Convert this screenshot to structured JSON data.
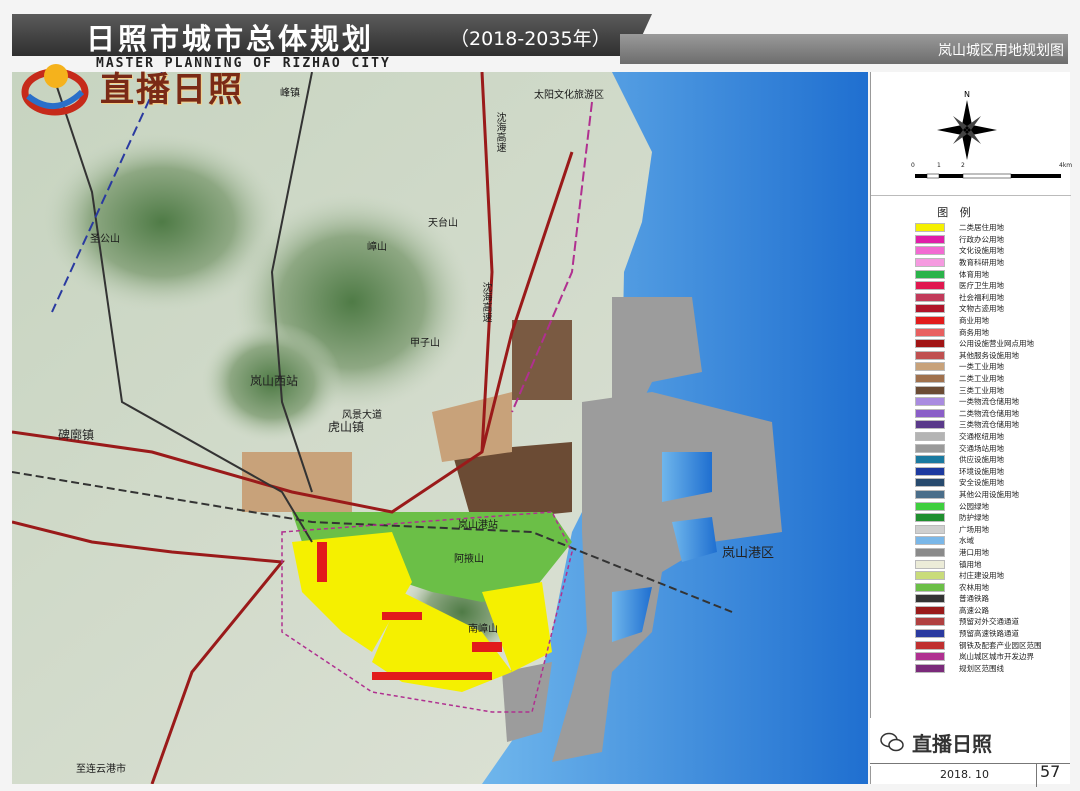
{
  "header": {
    "title_cn": "日照市城市总体规划",
    "title_years": "（2018-2035年）",
    "title_en": "MASTER PLANNING OF RIZHAO CITY",
    "subtitle": "岚山城区用地规划图"
  },
  "logo": {
    "text": "直播日照"
  },
  "map": {
    "labels": {
      "top_town": "峰镇",
      "taiyang": "太阳文化旅游区",
      "shenhai_highway": "沈海高速",
      "shenhai_highway2": "沈海高速",
      "tiantai": "天台山",
      "zhisheng": "圣公山",
      "rong": "嶂山",
      "jiajia": "甲子山",
      "lanshan_west_station": "岚山西站",
      "hushan_town": "虎山镇",
      "beizhai_town": "碑廓镇",
      "lanshan_port_station": "岚山港站",
      "afushan": "阿掖山",
      "nanshan": "南嶂山",
      "lanshan_port_zone": "岚山港区",
      "lianyungang": "至连云港市",
      "fenghua": "风景大道"
    }
  },
  "legend": {
    "title": "图 例",
    "scale_labels": [
      "0",
      "1",
      "2",
      "4km"
    ],
    "items": [
      {
        "label": "二类居住用地",
        "color": "#f5f000"
      },
      {
        "label": "行政办公用地",
        "color": "#e01ea8"
      },
      {
        "label": "文化设施用地",
        "color": "#f26ad2"
      },
      {
        "label": "教育科研用地",
        "color": "#f59ae0"
      },
      {
        "label": "体育用地",
        "color": "#2bb34a"
      },
      {
        "label": "医疗卫生用地",
        "color": "#e0174f"
      },
      {
        "label": "社会福利用地",
        "color": "#c23a5a"
      },
      {
        "label": "文物古迹用地",
        "color": "#b0142a"
      },
      {
        "label": "商业用地",
        "color": "#e21b1b"
      },
      {
        "label": "商务用地",
        "color": "#e86060"
      },
      {
        "label": "公用设施营业网点用地",
        "color": "#a11414"
      },
      {
        "label": "其他服务设施用地",
        "color": "#c05050"
      },
      {
        "label": "一类工业用地",
        "color": "#c8a27a"
      },
      {
        "label": "二类工业用地",
        "color": "#a0714d"
      },
      {
        "label": "三类工业用地",
        "color": "#6b4b34"
      },
      {
        "label": "一类物流仓储用地",
        "color": "#a98be0"
      },
      {
        "label": "二类物流仓储用地",
        "color": "#8a5ec8"
      },
      {
        "label": "三类物流仓储用地",
        "color": "#5a3a8a"
      },
      {
        "label": "交通枢纽用地",
        "color": "#b4b4b4"
      },
      {
        "label": "交通场站用地",
        "color": "#9a9a9a"
      },
      {
        "label": "供应设施用地",
        "color": "#1a7aa0"
      },
      {
        "label": "环境设施用地",
        "color": "#1d3aa0"
      },
      {
        "label": "安全设施用地",
        "color": "#274a6e"
      },
      {
        "label": "其他公用设施用地",
        "color": "#4a6e8a"
      },
      {
        "label": "公园绿地",
        "color": "#3ecf3e"
      },
      {
        "label": "防护绿地",
        "color": "#1f8f2f"
      },
      {
        "label": "广场用地",
        "color": "#cfcfcf"
      },
      {
        "label": "水域",
        "color": "#7ab7e8"
      },
      {
        "label": "港口用地",
        "color": "#8a8a8a"
      },
      {
        "label": "镇用地",
        "color": "#ececd8"
      },
      {
        "label": "村庄建设用地",
        "color": "#c9dc7a"
      },
      {
        "label": "农林用地",
        "color": "#6bbf47"
      },
      {
        "label": "普通铁路",
        "color": "#333333"
      },
      {
        "label": "高速公路",
        "color": "#9a1a1a"
      },
      {
        "label": "预留对外交通通道",
        "color": "#b04040"
      },
      {
        "label": "预留高速铁路通道",
        "color": "#2a3aa0"
      },
      {
        "label": "钢铁及配套产业园区范围",
        "color": "#c03030"
      },
      {
        "label": "岚山城区城市开发边界",
        "color": "#b03090"
      },
      {
        "label": "规划区范围线",
        "color": "#7a2a7a"
      }
    ]
  },
  "credit": {
    "text": "直播日照"
  },
  "footer": {
    "date": "2018. 10",
    "page": "57"
  }
}
